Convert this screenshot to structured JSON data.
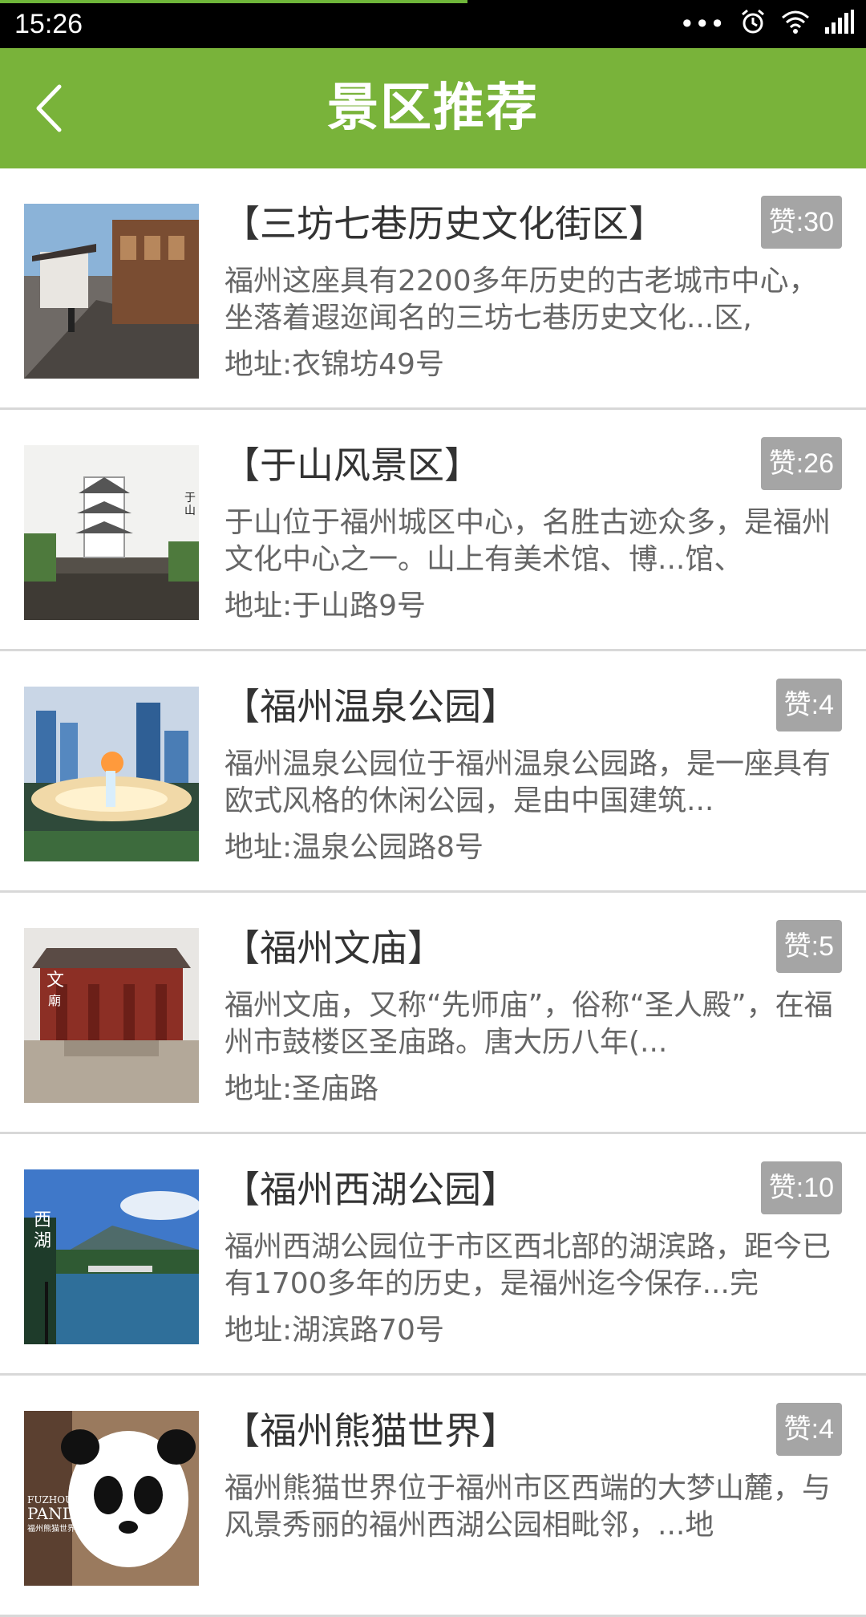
{
  "status_bar": {
    "time": "15:26",
    "icons": [
      "more-dots-icon",
      "alarm-icon",
      "wifi-icon",
      "signal-icon"
    ],
    "load_progress": 0.54
  },
  "header": {
    "title": "景区推荐",
    "back_icon": "chevron-left-icon",
    "background": "#79b33a"
  },
  "items": [
    {
      "name": "【三坊七巷历史文化街区】",
      "likes": "赞:30",
      "desc": "福州这座具有2200多年历史的古老城市中心，坐落着遐迩闻名的三坊七巷历史文化...区,",
      "address": "地址:衣锦坊49号"
    },
    {
      "name": "【于山风景区】",
      "likes": "赞:26",
      "desc": "于山位于福州城区中心，名胜古迹众多，是福州文化中心之一。山上有美术馆、博...馆、",
      "address": "地址:于山路9号"
    },
    {
      "name": "【福州温泉公园】",
      "likes": "赞:4",
      "desc": "福州温泉公园位于福州温泉公园路，是一座具有欧式风格的休闲公园，是由中国建筑...",
      "address": "地址:温泉公园路8号"
    },
    {
      "name": "【福州文庙】",
      "likes": "赞:5",
      "desc": "福州文庙，又称“先师庙”，俗称“圣人殿”，在福州市鼓楼区圣庙路。唐大历八年(...",
      "address": "地址:圣庙路"
    },
    {
      "name": "【福州西湖公园】",
      "likes": "赞:10",
      "desc": "福州西湖公园位于市区西北部的湖滨路，距今已有1700多年的历史，是福州迄今保存...完",
      "address": "地址:湖滨路70号"
    },
    {
      "name": "【福州熊猫世界】",
      "likes": "赞:4",
      "desc": "福州熊猫世界位于福州市区西端的大梦山麓，与风景秀丽的福州西湖公园相毗邻，...地",
      "address": ""
    }
  ]
}
